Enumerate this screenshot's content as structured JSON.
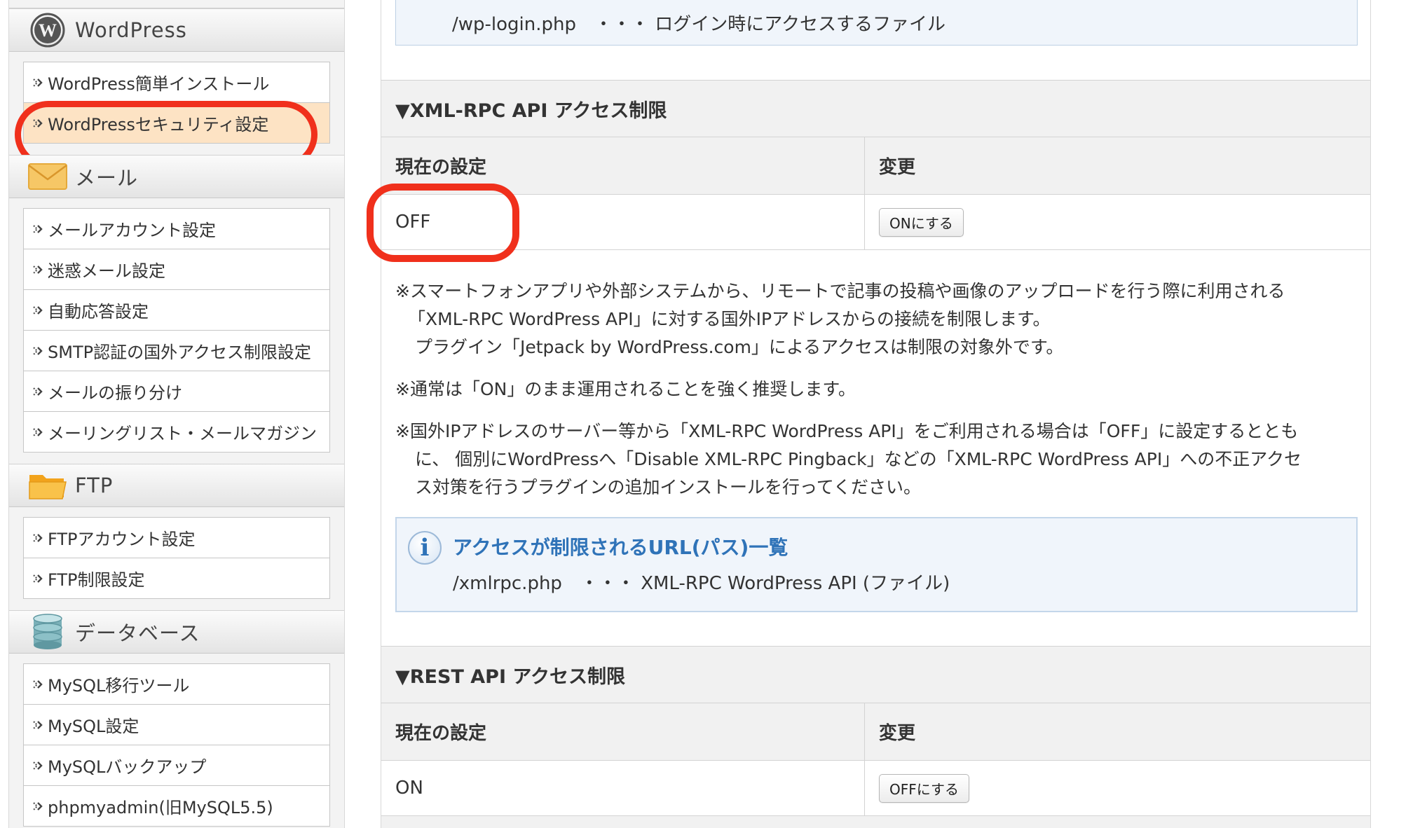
{
  "sidebar": {
    "sections": [
      {
        "icon": "wordpress-icon",
        "title": "WordPress",
        "items": [
          "WordPress簡単インストール",
          "WordPressセキュリティ設定"
        ],
        "active_index": 1
      },
      {
        "icon": "mail-envelope-icon",
        "title": "メール",
        "items": [
          "メールアカウント設定",
          "迷惑メール設定",
          "自動応答設定",
          "SMTP認証の国外アクセス制限設定",
          "メールの振り分け",
          "メーリングリスト・メールマガジン"
        ]
      },
      {
        "icon": "folder-icon",
        "title": "FTP",
        "items": [
          "FTPアカウント設定",
          "FTP制限設定"
        ]
      },
      {
        "icon": "database-icon",
        "title": "データベース",
        "items": [
          "MySQL移行ツール",
          "MySQL設定",
          "MySQLバックアップ",
          "phpmyadmin(旧MySQL5.5)"
        ]
      }
    ]
  },
  "main": {
    "top_box_text": "/wp-login.php　・・・ ログイン時にアクセスするファイル",
    "xmlrpc": {
      "heading": "▼XML-RPC API アクセス制限",
      "col_current": "現在の設定",
      "col_change": "変更",
      "current_value": "OFF",
      "button_label": "ONにする",
      "notes": [
        [
          "※スマートフォンアプリや外部システムから、リモートで記事の投稿や画像のアップロードを行う際に利用される",
          "「XML-RPC WordPress API」に対する国外IPアドレスからの接続を制限します。",
          "プラグイン「Jetpack by WordPress.com」によるアクセスは制限の対象外です。"
        ],
        [
          "※通常は「ON」のまま運用されることを強く推奨します。"
        ],
        [
          "※国外IPアドレスのサーバー等から「XML-RPC WordPress API」をご利用される場合は「OFF」に設定するととも",
          "に、 個別にWordPressへ「Disable XML-RPC Pingback」などの「XML-RPC WordPress API」への不正アクセ",
          "ス対策を行うプラグインの追加インストールを行ってください。"
        ]
      ],
      "info_title": "アクセスが制限されるURL(パス)一覧",
      "info_body": "/xmlrpc.php　・・・ XML-RPC WordPress API (ファイル)"
    },
    "rest": {
      "heading": "▼REST API アクセス制限",
      "col_current": "現在の設定",
      "col_change": "変更",
      "current_value": "ON",
      "button_label": "OFFにする"
    }
  },
  "colors": {
    "highlight_red": "#f0301c",
    "active_item_bg": "#fde3c4",
    "info_title_blue": "#2f73b8",
    "info_box_bg": "#f0f5fb"
  }
}
